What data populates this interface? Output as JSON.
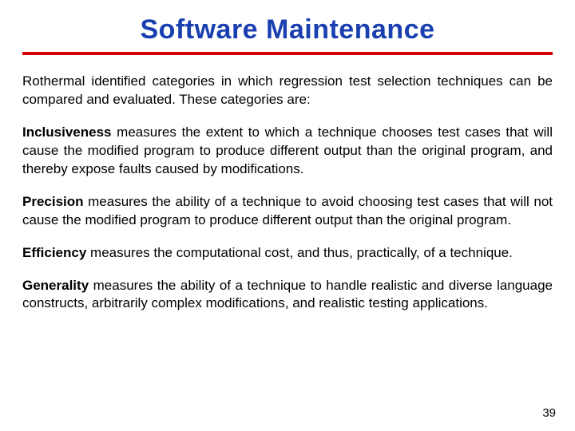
{
  "title": "Software Maintenance",
  "intro": "Rothermal identified categories in which regression test selection techniques can be compared and evaluated. These categories are:",
  "items": [
    {
      "term": "Inclusiveness",
      "text": " measures the extent to which a technique chooses test cases that will cause the modified program to produce different output than the original program, and thereby expose faults caused by modifications."
    },
    {
      "term": "Precision",
      "text": " measures the ability of a technique to avoid choosing test cases that will not cause the modified program to produce different output than the original program."
    },
    {
      "term": "Efficiency",
      "text": " measures the computational cost, and thus, practically, of a technique."
    },
    {
      "term": "Generality",
      "text": " measures the ability of a technique to handle realistic and diverse language constructs, arbitrarily complex modifications, and realistic testing applications."
    }
  ],
  "page_number": "39"
}
